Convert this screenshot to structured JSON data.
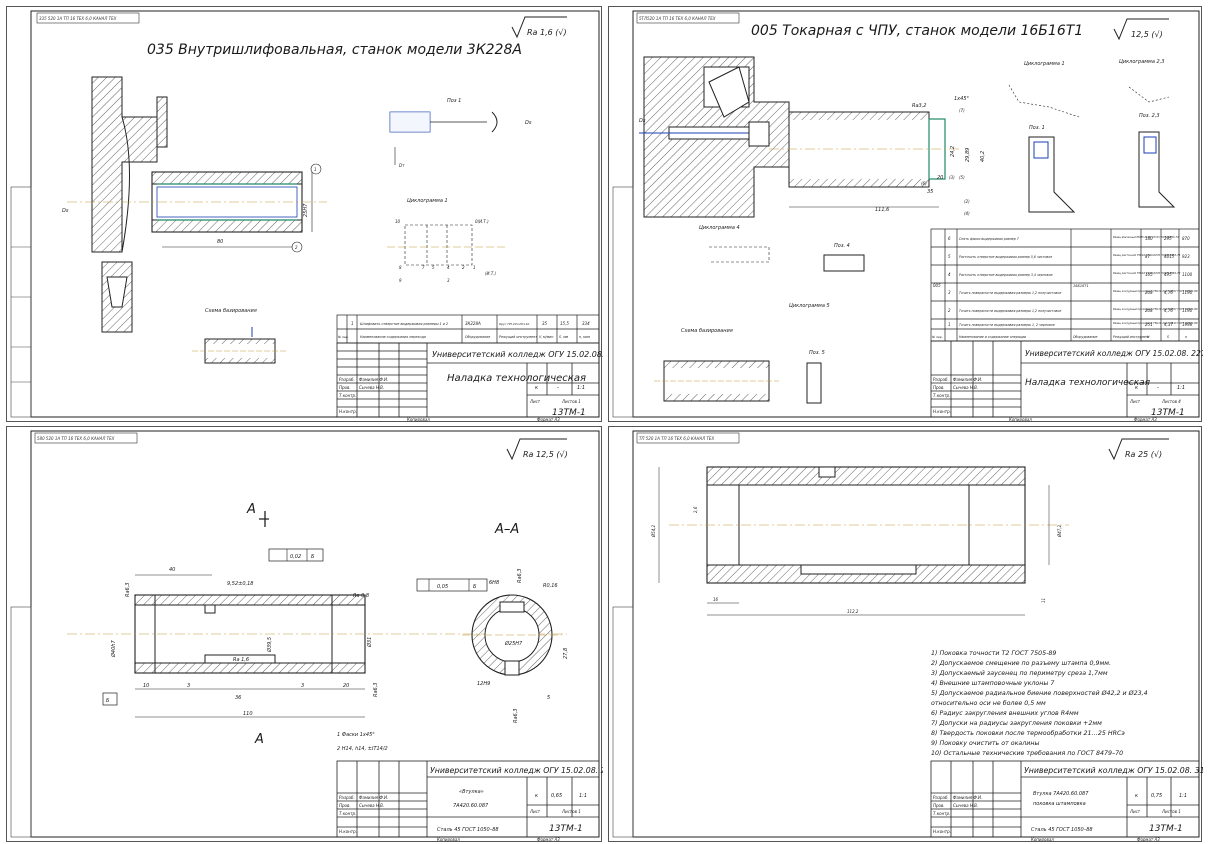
{
  "sheets": {
    "tl": {
      "corner_stamp": "335 520 1А ТП 16 ТЕХ 6,0 КАНАЛ ТЕХ",
      "ra": "Ra 1,6 (√)",
      "title": "035 Внутришлифовальная, станок модели 3К228А",
      "pos1": "Поз 1",
      "cyclogram": "Циклограмма 1",
      "scheme": "Схема базирования",
      "dims": {
        "d1": "80",
        "d2": "25Н7",
        "c1": "1",
        "c2": "2",
        "ds": "Ds",
        "dsm": "Ds",
        "d_lbl": "Dт",
        "oi": "0(И.Т.)",
        "it": "(И.Т.)",
        "n10": "10",
        "n8": "8",
        "n9": "9",
        "n7": "7",
        "n5": "5",
        "n4": "4",
        "n2": "2",
        "n3": "3",
        "n1": "1"
      },
      "table": {
        "rows": [
          [
            "1",
            "Шлифовать отверстие выдерживая размеры 1 и 2",
            "3К228А",
            "Круг ПП 40×20×10",
            "35",
            "15,5",
            "334"
          ]
        ],
        "headers": [
          "№ пер.",
          "Наименование содержания перехода",
          "Оборудование",
          "Режущий инструмент",
          "V, м/мин",
          "S, мм",
          "n, мин"
        ]
      },
      "stamp": {
        "org": "Университетский колледж ОГУ 15.02.08. 2217. 025. 505",
        "doc": "Наладка технологическая",
        "lit": "к",
        "mass": "-",
        "scale": "1:1",
        "sheet": "Лист",
        "sheets": "Листов 1",
        "group": "13ТМ-1",
        "razrab": "Разраб.",
        "prov": "Пров.",
        "tkontr": "Т.контр.",
        "nkontr": "Н.контр.",
        "utv": "Утв.",
        "name1": "Фамилия Ф.И.",
        "name2": "Сычева Н.В.",
        "copy": "Копировал",
        "format": "Формат А3"
      }
    },
    "tr": {
      "corner_stamp": "5ТЛ520 1А ТП 16 ТЕХ 6,0 КАНАЛ ТЕХ",
      "ra": "12,5 (√)",
      "title": "005 Токарная с ЧПУ, станок модели 16Б16Т1",
      "cyc1": "Циклограмма 1",
      "cyc23": "Циклограмма 2,3",
      "cyc4": "Циклограмма 4",
      "cyc5": "Циклограмма 5",
      "pos1": "Поз. 1",
      "pos23": "Поз. 2,3",
      "pos4": "Поз. 4",
      "pos5": "Поз. 5",
      "scheme": "Схема базирования",
      "dims": {
        "d1": "1х45°",
        "d2": "Ra3,2",
        "d3": "24,2",
        "d4": "29,89",
        "d5": "40,2",
        "d6": "20",
        "d7": "35",
        "d8": "111,6",
        "c1": "(1)",
        "c2": "(2)",
        "c3": "(3)",
        "c4": "(4)",
        "c5": "(5)",
        "c6": "(6)",
        "c7": "(7)",
        "ds": "Ds"
      },
      "ops": [
        [
          "6",
          "Снять фаски выдерживая размер 7",
          "Резец фасонный Р6М5 2106-0710 ГОСТ18883-73",
          "180",
          "295",
          "870"
        ],
        [
          "5",
          "Расточить отверстие выдерживая размер 5,6 чистовое",
          "Резец расточной Т5К10 2140-0070 ГОСТ18882-73",
          "87",
          "4615",
          "923"
        ],
        [
          "4",
          "Расточить отверстие выдерживая размер 3,4 черновое",
          "Резец расточной Т5К10 2140-0070 ГОСТ18882-73",
          "165",
          "495",
          "1100"
        ],
        [
          "3",
          "Точить поверхности выдерживая размеры 1,2 получистовое",
          "Резец контурный проходной Т5К10 2103-0697 ГОСТ 20872-80",
          "208",
          "4,76",
          "1190"
        ],
        [
          "2",
          "Точить поверхности выдерживая размеры 1,2 получистовое",
          "Резец контурный проходной Т5К10 2103-0697 ГОСТ 20872-80",
          "208",
          "4,76",
          "1190"
        ],
        [
          "1",
          "Точить поверхности выдерживая размеры 1, 2 черновое",
          "Резец контурный проходной Т5К10 2101-0643 ГОСТ 20872-80",
          "251",
          "4,37",
          "1998"
        ]
      ],
      "op_num": "005",
      "machine": "16Б16Т1",
      "headers": [
        "№ пер.",
        "Наименование и содержание операции",
        "Оборудование",
        "Режущий инструмент",
        "V",
        "S",
        "n"
      ],
      "stamp": {
        "org": "Университетский колледж ОГУ 15.02.08. 2217. 025. 04. 05",
        "doc": "Наладка технологическая",
        "lit": "к",
        "mass": "-",
        "scale": "1:1",
        "sheets": "Листов 4",
        "sheet": "Лист",
        "group": "13ТМ-1",
        "razrab": "Разраб.",
        "prov": "Пров.",
        "tkontr": "Т.контр.",
        "nkontr": "Н.контр.",
        "utv": "Утв.",
        "name1": "Фамилия Ф.И.",
        "name2": "Сычева Н.В.",
        "copy": "Копировал",
        "format": "Формат А3"
      }
    },
    "bl": {
      "corner_stamp": "580 520 1А ТП 16 ТЕХ 6,0 КАНАЛ ТЕХ",
      "ra": "Ra 12,5 (√)",
      "section_a": "А",
      "section_aa": "А–А",
      "dims": {
        "d40": "40",
        "d952": "9,52±0,18",
        "d002": "0,02",
        "b": "Б",
        "ra08": "Ra 0,8",
        "ra63a": "Ra6,3",
        "ra63b": "Ra6,3",
        "ra63c": "Ra6,3",
        "ra63d": "Ra6,3",
        "d40h7": "Ø40h7",
        "d395": "Ø39,5",
        "d31": "Ø31",
        "ra16": "Ra 1,6",
        "d10": "10",
        "d3a": "3",
        "d36": "36",
        "d3b": "3",
        "d20": "20",
        "d110": "110",
        "tol": "0,05",
        "d6h8": "6Н8",
        "r016": "R0,16",
        "d25h7": "Ø25Н7",
        "d278": "27,8",
        "d12h9": "12Н9",
        "d5": "5"
      },
      "notes": [
        "1  Фаски 1х45°",
        "2  Н14, h14, ±IT14/2"
      ],
      "stamp": {
        "org": "Университетский колледж ОГУ 15.02.08. 2217. 025. 0105",
        "title1": "«Втулка»",
        "title2": "7А420.60.087",
        "material": "Сталь 45 ГОСТ 1050–88",
        "lit": "к",
        "mass": "0,65",
        "scale": "1:1",
        "sheet": "Лист",
        "sheets": "Листов 1",
        "group": "13ТМ-1",
        "razrab": "Разраб.",
        "prov": "Пров.",
        "tkontr": "Т.контр.",
        "nkontr": "Н.контр.",
        "utv": "Утв.",
        "name1": "Фамилия Ф.И.",
        "name2": "Сычева Н.В.",
        "copy": "Копировал",
        "format": "Формат А3"
      }
    },
    "br": {
      "corner_stamp": "ТП 520 1А ТП 16 ТЕХ 6,0 КАНАЛ ТЕХ",
      "ra": "Ra 25 (√)",
      "dims": {
        "d1": "Ø54,2",
        "d2": "Ø47,2",
        "d3": "16",
        "d4": "112,2",
        "d5": "11",
        "d6": "2,6"
      },
      "notes": [
        "1) Поковка точности Т2 ГОСТ 7505-89",
        "2) Допускаемое смещение по разъему штампа 0,9мм.",
        "3) Допускаемый заусенец по периметру среза 1,7мм",
        "4) Внешние штамповочные уклоны 7",
        "5) Допускаемое радиальное биение поверхностей Ø42,2 и Ø23,4",
        "   относительно оси не более 0,5 мм",
        "6) Радиус закругления внешних углов R4мм",
        "7) Допуски на радиусы закругления поковки +2мм",
        "8) Твердость поковки после термообработки 21…25 HRCэ",
        "9) Поковку очистить от окалины",
        "10) Остальные технические требования по ГОСТ 8479–70"
      ],
      "stamp": {
        "org": "Университетский колледж ОГУ 15.02.08. 3117. 025. 02",
        "title1": "Втулка 7А420.60.087",
        "title2": "поковка штамповка",
        "material": "Сталь 45 ГОСТ 1050–88",
        "lit": "к",
        "mass": "0,75",
        "scale": "1:1",
        "sheet": "Лист",
        "sheets": "Листов 1",
        "group": "13ТМ-1",
        "razrab": "Разраб.",
        "prov": "Пров.",
        "tkontr": "Т.контр.",
        "nkontr": "Н.контр.",
        "utv": "Утв.",
        "name1": "Фамилия Ф.И.",
        "name2": "Сычева Н.В.",
        "copy": "Копировал",
        "format": "Формат А3"
      }
    }
  },
  "colors": {
    "line": "#1a1a1a",
    "center": "#c49a3a",
    "accent": "#1a3fb0",
    "green": "#1f8a6a"
  }
}
